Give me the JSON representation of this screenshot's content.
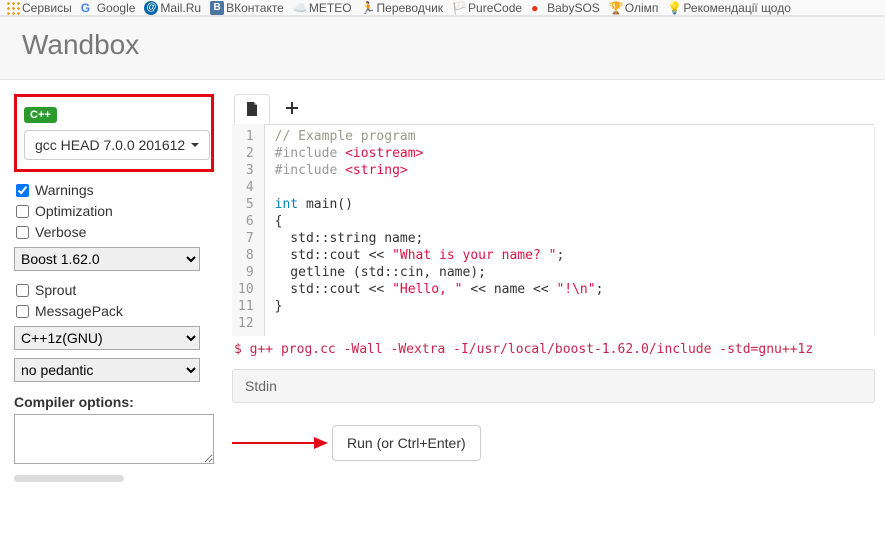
{
  "bookmarks": [
    {
      "name": "services",
      "label": "Сервисы",
      "iconKind": "grid"
    },
    {
      "name": "google",
      "label": "Google",
      "iconKind": "g"
    },
    {
      "name": "mailru",
      "label": "Mail.Ru",
      "iconKind": "at"
    },
    {
      "name": "vk",
      "label": "ВКонтакте",
      "iconKind": "vk"
    },
    {
      "name": "meteo",
      "label": "METEO",
      "iconKind": "cloud"
    },
    {
      "name": "transl",
      "label": "Переводчик",
      "iconKind": "stick"
    },
    {
      "name": "purecode",
      "label": "PureCode",
      "iconKind": "flag"
    },
    {
      "name": "babysos",
      "label": "BabySOS",
      "iconKind": "dot"
    },
    {
      "name": "olimp",
      "label": "Олімп",
      "iconKind": "cup"
    },
    {
      "name": "reco",
      "label": "Рекомендації щодо",
      "iconKind": "bulb"
    }
  ],
  "brand": "Wandbox",
  "sidebar": {
    "language_pill": "C++",
    "compiler_label": "gcc HEAD 7.0.0 201612",
    "warnings": {
      "label": "Warnings",
      "checked": true
    },
    "optimization": {
      "label": "Optimization",
      "checked": false
    },
    "verbose": {
      "label": "Verbose",
      "checked": false
    },
    "boost": {
      "options": [
        "Boost 1.62.0"
      ],
      "value": "Boost 1.62.0"
    },
    "sprout": {
      "label": "Sprout",
      "checked": false
    },
    "msgpack": {
      "label": "MessagePack",
      "checked": false
    },
    "std": {
      "options": [
        "C++1z(GNU)"
      ],
      "value": "C++1z(GNU)"
    },
    "pedantic": {
      "options": [
        "no pedantic"
      ],
      "value": "no pedantic"
    },
    "compiler_options_label": "Compiler options:",
    "compiler_options_value": ""
  },
  "editor": {
    "line_count": 12,
    "code_html": "<span class=\"c-cmt\">// Example program</span>\n<span class=\"c-pp\">#include</span> <span class=\"c-str\">&lt;iostream&gt;</span>\n<span class=\"c-pp\">#include</span> <span class=\"c-str\">&lt;string&gt;</span>\n\n<span class=\"c-kw\">int</span> <span class=\"c-sym\">main</span>()\n{\n  std::string name;\n  std::cout &lt;&lt; <span class=\"c-str\">\"What is your name? \"</span>;\n  getline (std::cin, name);\n  std::cout &lt;&lt; <span class=\"c-str\">\"Hello, \"</span> &lt;&lt; name &lt;&lt; <span class=\"c-str\">\"!\\n\"</span>;\n}\n"
  },
  "command_line": "$ g++ prog.cc -Wall -Wextra -I/usr/local/boost-1.62.0/include -std=gnu++1z",
  "stdin_label": "Stdin",
  "run_label": "Run (or Ctrl+Enter)"
}
